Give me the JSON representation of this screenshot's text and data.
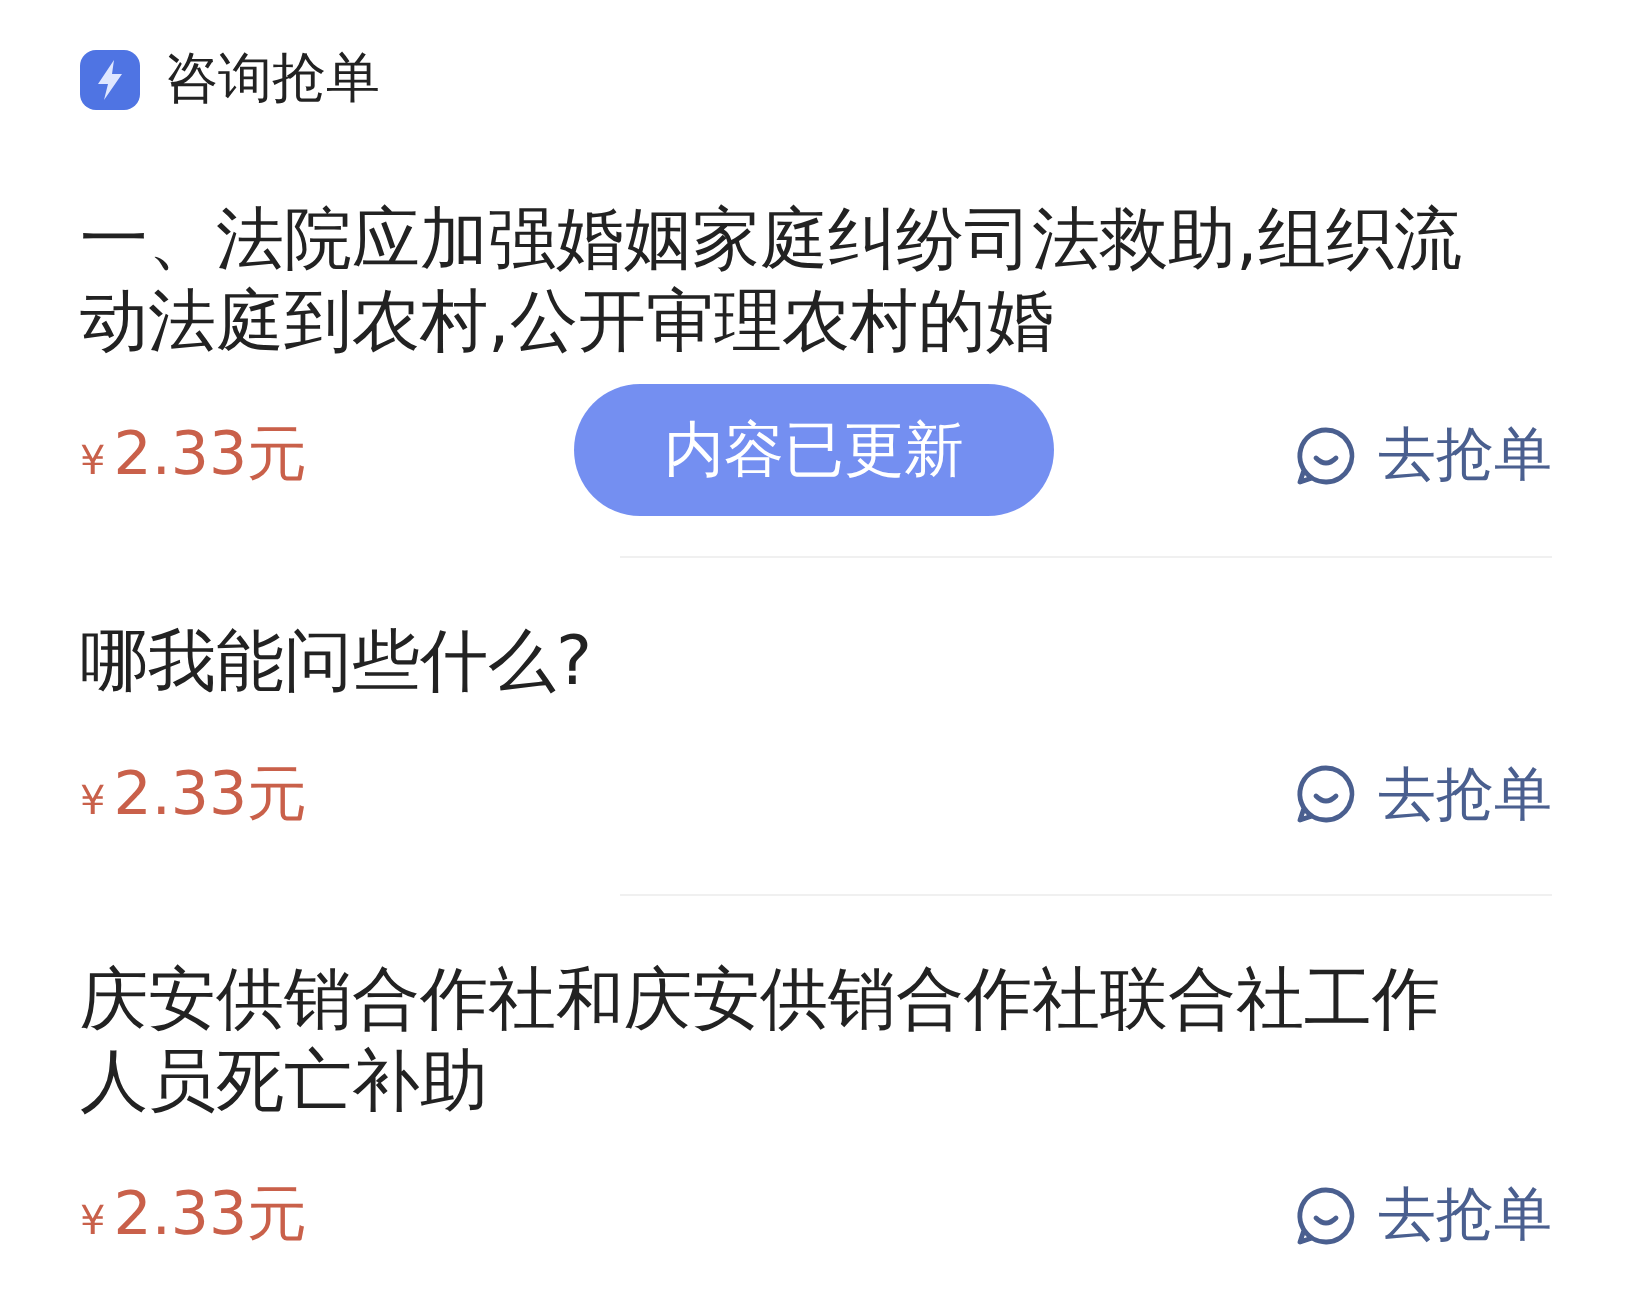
{
  "header": {
    "title": "咨询抢单"
  },
  "orders": [
    {
      "question": "一、法院应加强婚姻家庭纠纷司法救助,组织流动法庭到农村,公开审理农村的婚",
      "currency": "¥",
      "price": "2.33元",
      "action": "去抢单"
    },
    {
      "question": "哪我能问些什么?",
      "currency": "¥",
      "price": "2.33元",
      "action": "去抢单"
    },
    {
      "question": "庆安供销合作社和庆安供销合作社联合社工作人员死亡补助",
      "currency": "¥",
      "price": "2.33元",
      "action": "去抢单"
    }
  ],
  "toast": {
    "text": "内容已更新"
  }
}
